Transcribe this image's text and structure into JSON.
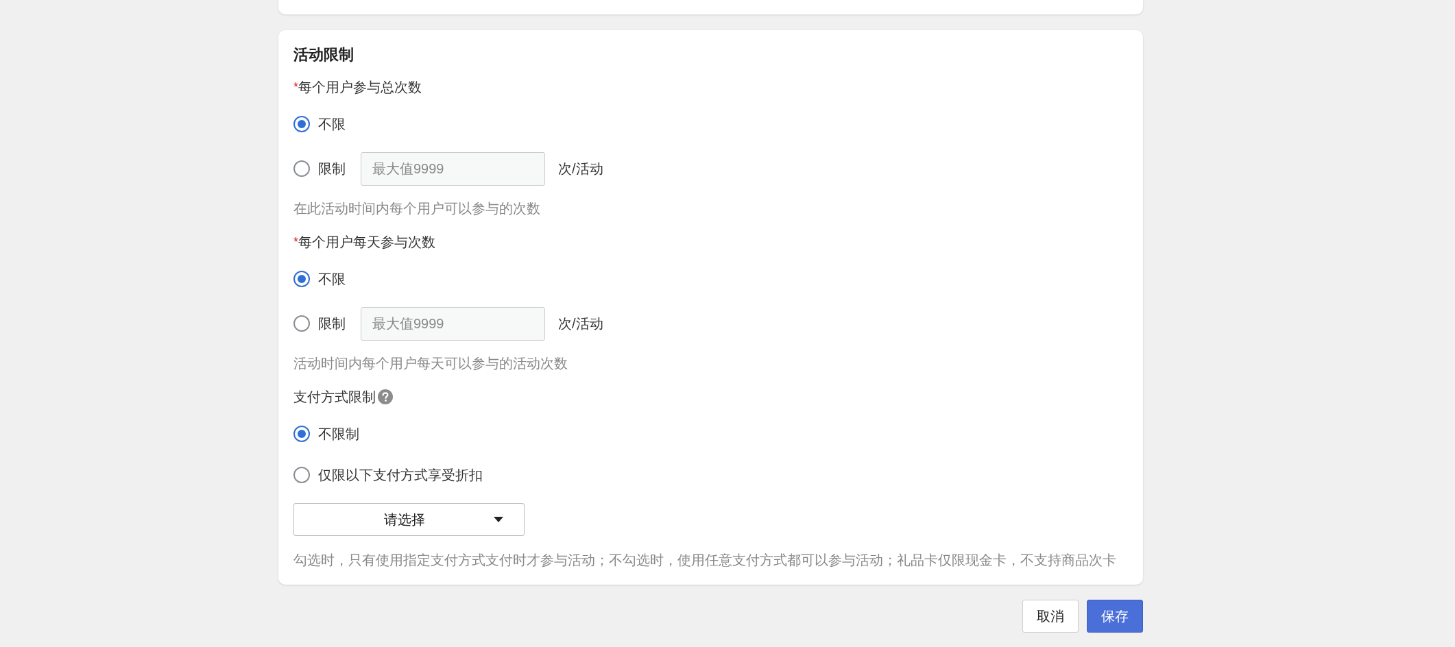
{
  "card": {
    "title": "活动限制",
    "sections": [
      {
        "marker": "*",
        "label": "每个用户参与总次数",
        "help": false,
        "options": [
          {
            "kind": "plain",
            "label": "不限",
            "selected": true
          },
          {
            "kind": "limit",
            "label": "限制",
            "selected": false,
            "placeholder": "最大值9999",
            "unit": "次/活动"
          }
        ],
        "hint": "在此活动时间内每个用户可以参与的次数"
      },
      {
        "marker": "*",
        "label": "每个用户每天参与次数",
        "help": false,
        "options": [
          {
            "kind": "plain",
            "label": "不限",
            "selected": true
          },
          {
            "kind": "limit",
            "label": "限制",
            "selected": false,
            "placeholder": "最大值9999",
            "unit": "次/活动"
          }
        ],
        "hint": "活动时间内每个用户每天可以参与的活动次数"
      },
      {
        "label": "支付方式限制",
        "help": true,
        "options": [
          {
            "kind": "plain",
            "label": "不限制",
            "selected": true
          },
          {
            "kind": "plain",
            "label": "仅限以下支付方式享受折扣",
            "selected": false
          }
        ],
        "select": {
          "placeholder": "请选择"
        },
        "hint": "勾选时，只有使用指定支付方式支付时才参与活动；不勾选时，使用任意支付方式都可以参与活动；礼品卡仅限现金卡，不支持商品次卡"
      }
    ]
  },
  "buttons": [
    {
      "kind": "secondary",
      "label": "取消"
    },
    {
      "kind": "primary",
      "label": "保存"
    }
  ]
}
